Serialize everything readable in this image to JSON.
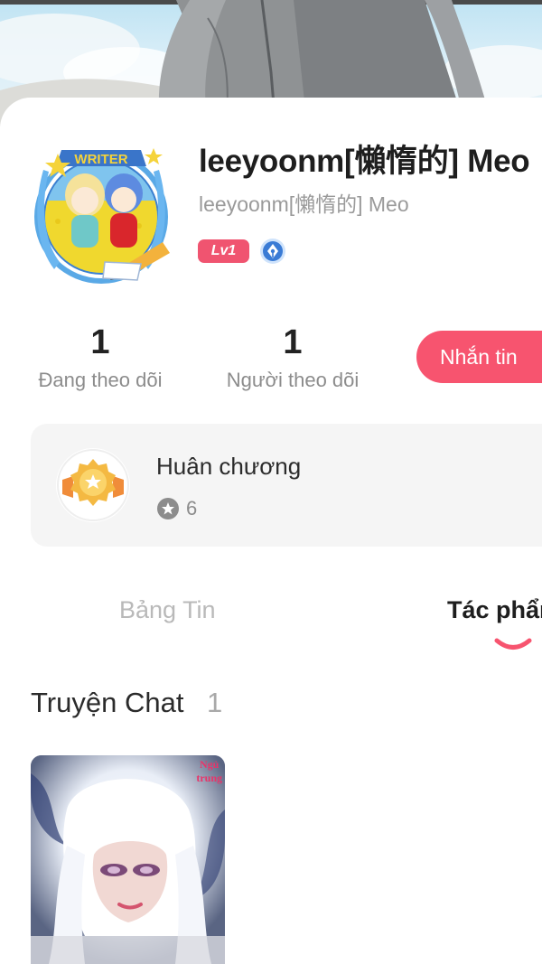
{
  "profile": {
    "name": "leeyoonm[懶惰的] Meo",
    "subname": "leeyoonm[懶惰的] Meo",
    "avatar_badge_text": "WRITER",
    "level_badge": "Lv1",
    "writer_badge_icon": "pen-nib-icon"
  },
  "stats": {
    "following_count": "1",
    "following_label": "Đang theo dõi",
    "followers_count": "1",
    "followers_label": "Người theo dõi"
  },
  "message_button": {
    "label": "Nhắn tin"
  },
  "medals": {
    "title": "Huân chương",
    "count": "6",
    "icon": "medal-icon"
  },
  "tabs": [
    {
      "label": "Bảng Tin",
      "active": false
    },
    {
      "label": "Tác phẩm",
      "active": true
    }
  ],
  "section": {
    "title": "Truyện Chat",
    "count": "1"
  },
  "stories": [
    {
      "cover_text": "Ngủ\ntrung"
    }
  ],
  "colors": {
    "accent": "#f7546f",
    "level_badge": "#f05470",
    "writer_badge": "#3a7bd5",
    "medal_gold": "#f4b942"
  }
}
